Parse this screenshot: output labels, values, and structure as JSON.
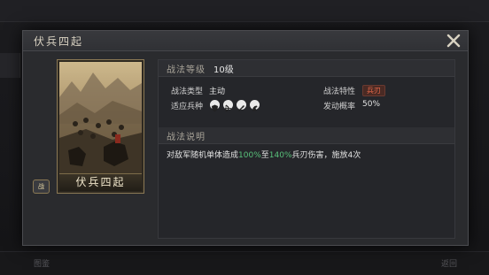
{
  "background": {
    "bottom_left": "图鉴",
    "bottom_right": "返回"
  },
  "modal": {
    "title": "伏兵四起",
    "close_icon": "close-x-icon"
  },
  "card": {
    "name": "伏兵四起",
    "badge": "战"
  },
  "info": {
    "level_label": "战法等级",
    "level_value": "10级",
    "type_label": "战法类型",
    "type_value": "主动",
    "trait_label": "战法特性",
    "trait_value": "兵刃",
    "units_label": "适应兵种",
    "units_icons": [
      "shield-icon",
      "bow-icon",
      "spear-icon",
      "cavalry-icon"
    ],
    "chance_label": "发动概率",
    "chance_value": "50%",
    "desc_label": "战法说明",
    "desc_part1": "对敌军随机单体造成",
    "desc_pct1": "100%",
    "desc_part2": "至",
    "desc_pct2": "140%",
    "desc_part3": "兵刃伤害，施放4次"
  },
  "colors": {
    "accent_gold": "#8c7a55",
    "trait_red": "#e86a4a",
    "value_green": "#58c07a"
  }
}
